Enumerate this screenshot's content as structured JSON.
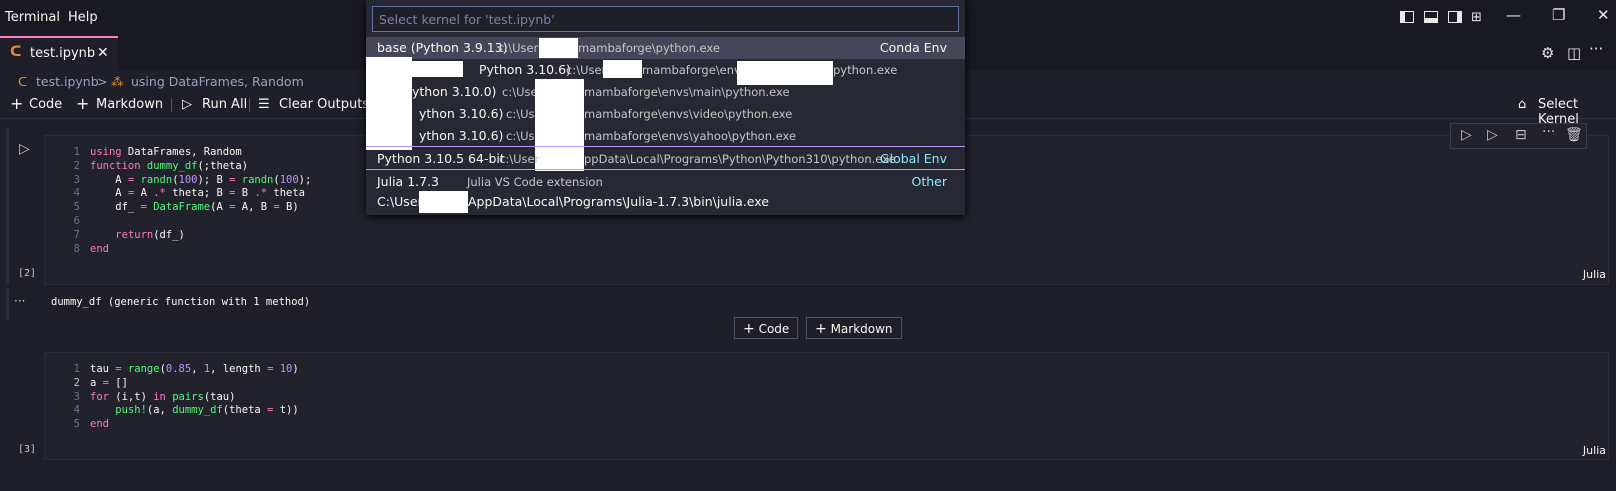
{
  "titlebar": {
    "menu": [
      "Terminal",
      "Help"
    ],
    "window_controls": [
      "minimize-icon",
      "restore-icon",
      "close-icon"
    ]
  },
  "tab": {
    "label": "test.ipynb",
    "close": "✕"
  },
  "breadcrumb": {
    "file": "test.ipynb",
    "separator": ">",
    "symbol": "using DataFrames, Random"
  },
  "toolbar": {
    "code": "Code",
    "markdown": "Markdown",
    "run_all": "Run All",
    "clear_outputs": "Clear Outputs o",
    "select_kernel": "Select Kernel"
  },
  "kernel_picker": {
    "placeholder": "Select kernel for 'test.ipynb'",
    "items": [
      {
        "label": "base (Python 3.9.13)",
        "desc_a": "c:\\Users",
        "desc_b": "mambaforge\\python.exe",
        "tag": "Conda Env"
      },
      {
        "label": "Python 3.10.6)",
        "desc_a": "c:\\User",
        "desc_b": "mambaforge\\envs",
        "desc_c": "python.exe",
        "tag": ""
      },
      {
        "label": "ython 3.10.0)",
        "desc_a": "c:\\Users",
        "desc_b": "mambaforge\\envs\\main\\python.exe",
        "tag": ""
      },
      {
        "label": "ython 3.10.6)",
        "desc_a": "c:\\User",
        "desc_b": "mambaforge\\envs\\video\\python.exe",
        "tag": ""
      },
      {
        "label": "ython 3.10.6)",
        "desc_a": "c:\\User",
        "desc_b": "mambaforge\\envs\\yahoo\\python.exe",
        "tag": ""
      },
      {
        "label": "Python 3.10.5 64-bit",
        "desc_a": "c:\\User",
        "desc_b": "ppData\\Local\\Programs\\Python\\Python310\\python.exe",
        "tag": "Global Env"
      },
      {
        "label": "Julia 1.7.3",
        "desc_a": "Julia VS Code extension",
        "desc_b": "",
        "tag": "Other"
      }
    ],
    "julia_path_a": "C:\\User",
    "julia_path_b": "AppData\\Local\\Programs\\Julia-1.7.3\\bin\\julia.exe"
  },
  "cell1": {
    "line_numbers": [
      "1",
      "2",
      "3",
      "4",
      "5",
      "6",
      "7",
      "8"
    ],
    "exec_count": "[2]",
    "language": "Julia",
    "output": "dummy_df (generic function with 1 method)"
  },
  "cell2": {
    "line_numbers": [
      "1",
      "2",
      "3",
      "4",
      "5"
    ],
    "exec_count": "[3]",
    "language": "Julia"
  },
  "add_cell": {
    "code": "Code",
    "markdown": "Markdown"
  },
  "output_more": "···"
}
